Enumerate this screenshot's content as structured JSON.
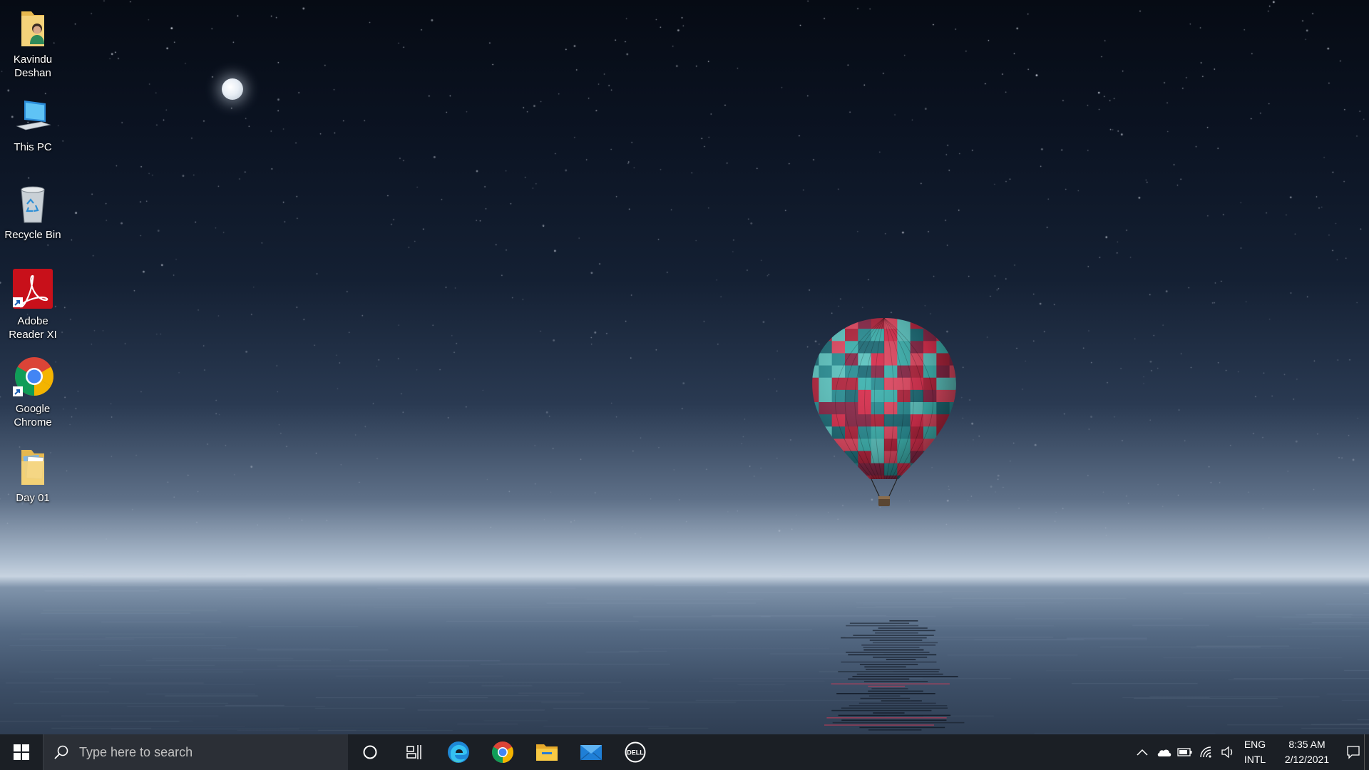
{
  "desktop": {
    "wallpaper": "night sky with moon, hot air balloon over calm water",
    "icons": [
      {
        "label": "Kavindu Deshan",
        "icon": "user-folder-icon"
      },
      {
        "label": "This PC",
        "icon": "computer-icon"
      },
      {
        "label": "Recycle Bin",
        "icon": "recycle-bin-icon"
      },
      {
        "label": "Adobe Reader XI",
        "icon": "adobe-reader-icon"
      },
      {
        "label": "Google Chrome",
        "icon": "chrome-icon"
      },
      {
        "label": "Day 01",
        "icon": "folder-icon"
      }
    ]
  },
  "taskbar": {
    "search": {
      "placeholder": "Type here to search"
    },
    "pinned": [
      "cortana-icon",
      "task-view-icon",
      "edge-icon",
      "chrome-icon",
      "file-explorer-icon",
      "mail-icon",
      "dell-icon"
    ],
    "tray": {
      "language_top": "ENG",
      "language_bottom": "INTL",
      "time": "8:35 AM",
      "date": "2/12/2021"
    },
    "colors": {
      "taskbar_bg": "#1b1f25",
      "search_bg": "#2b2f36"
    }
  }
}
